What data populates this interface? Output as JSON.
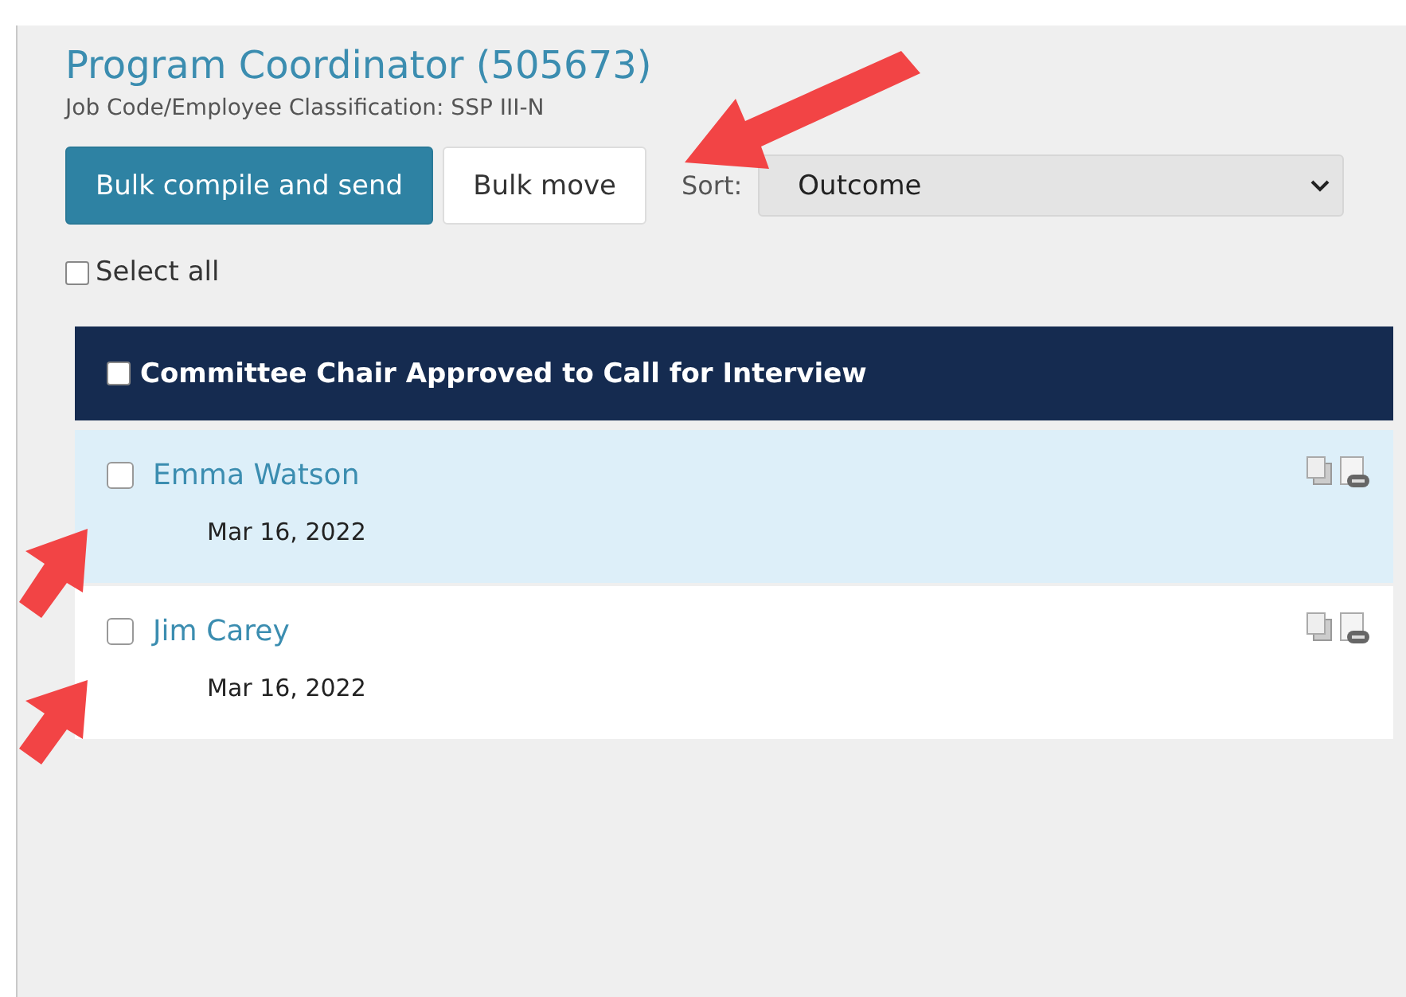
{
  "job": {
    "title": "Program Coordinator (505673)",
    "classification": "Job Code/Employee Classification: SSP III-N"
  },
  "toolbar": {
    "buttons": [
      {
        "label": "Bulk compile and send",
        "kind": "primary"
      },
      {
        "label": "Bulk move",
        "kind": "secondary"
      }
    ],
    "sort_label": "Sort:",
    "sort_value": "Outcome"
  },
  "select_all": {
    "label": "Select all",
    "checked": false
  },
  "group": {
    "title": "Committee Chair Approved to Call for Interview",
    "checked": false,
    "candidates": [
      {
        "name": "Emma Watson",
        "date": "Mar 16, 2022",
        "selected": true,
        "checked": false
      },
      {
        "name": "Jim Carey",
        "date": "Mar 16, 2022",
        "selected": false,
        "checked": false
      }
    ]
  }
}
